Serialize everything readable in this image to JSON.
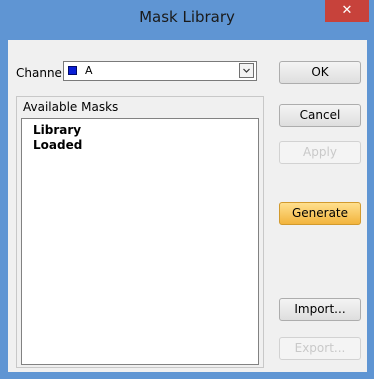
{
  "window": {
    "title": "Mask Library",
    "close_glyph": "✕"
  },
  "channel": {
    "label": "Channel",
    "value": "A",
    "swatch_color": "#0a1fd6"
  },
  "masks": {
    "header": "Available Masks",
    "items": [
      "Library",
      "Loaded"
    ]
  },
  "buttons": {
    "ok": "OK",
    "cancel": "Cancel",
    "apply": "Apply",
    "generate": "Generate",
    "import": "Import...",
    "export": "Export..."
  },
  "colors": {
    "titlebar": "#5f95d3",
    "close": "#c7423b",
    "generate": "#f2b43d"
  }
}
